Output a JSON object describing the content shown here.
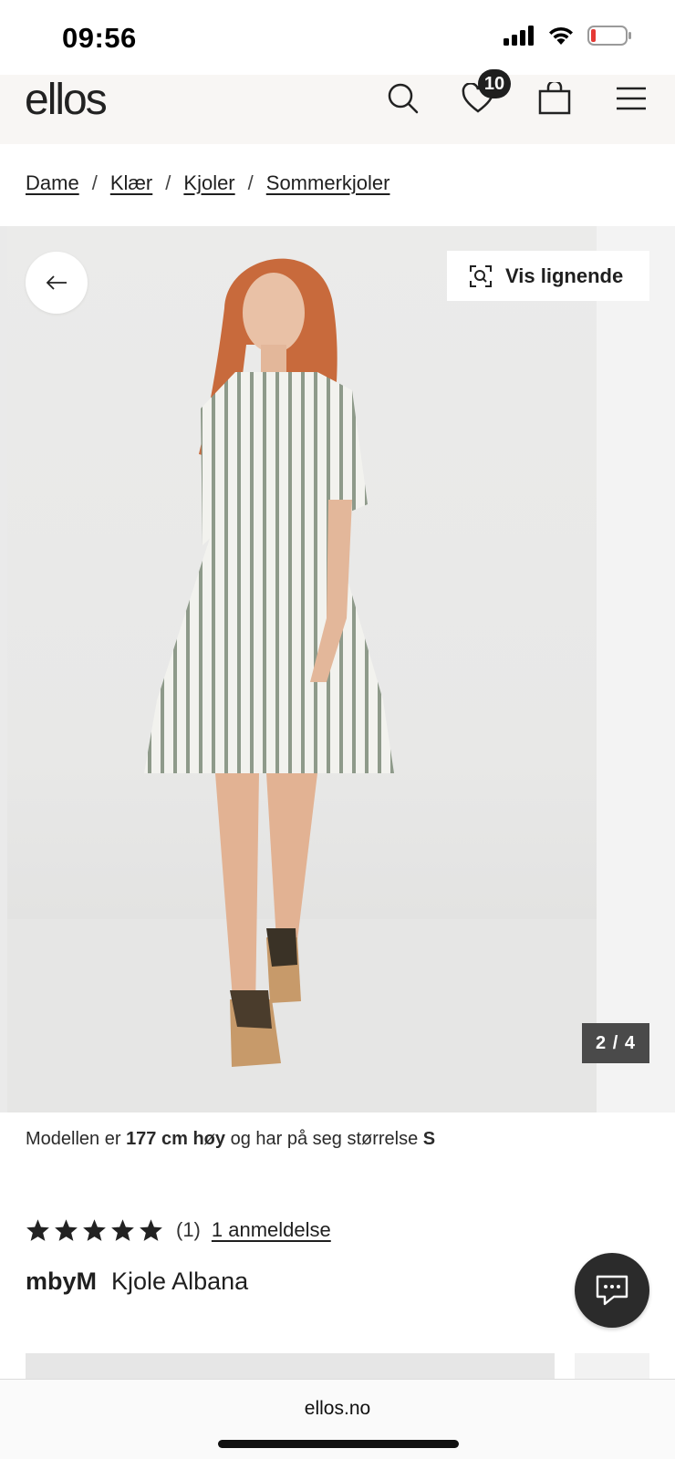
{
  "status_bar": {
    "time": "09:56"
  },
  "header": {
    "logo": "ellos",
    "wishlist_count": "10",
    "icons": [
      "search-icon",
      "heart-icon",
      "bag-icon",
      "menu-icon"
    ]
  },
  "breadcrumb": {
    "items": [
      "Dame",
      "Klær",
      "Kjoler",
      "Sommerkjoler"
    ],
    "separator": "/"
  },
  "gallery": {
    "similar_label": "Vis lignende",
    "counter": "2 / 4"
  },
  "model_info": {
    "prefix": "Modellen er ",
    "height": "177 cm høy",
    "middle": " og har på seg størrelse ",
    "size": "S"
  },
  "product": {
    "rating_stars": 5,
    "rating_count": "(1)",
    "reviews_link": "1 anmeldelse",
    "brand": "mbyM",
    "name": "Kjole Albana"
  },
  "browser": {
    "url": "ellos.no"
  },
  "colors": {
    "text": "#1f1f1f",
    "header_bg": "#f8f6f4",
    "badge_bg": "#1f1f1f",
    "counter_bg": "#4a4a4a",
    "chat_bg": "#2b2b2b",
    "battery_low": "#e53935"
  }
}
